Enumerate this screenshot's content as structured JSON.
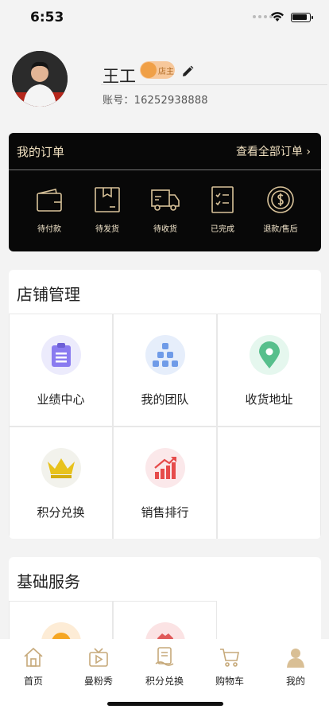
{
  "status_bar": {
    "time": "6:53"
  },
  "profile": {
    "name": "王工",
    "badge": "店主",
    "account_label": "账号：16252938888"
  },
  "orders": {
    "title": "我的订单",
    "view_all": "查看全部订单 ›",
    "items": [
      {
        "label": "待付款",
        "icon": "wallet-icon"
      },
      {
        "label": "待发货",
        "icon": "package-icon"
      },
      {
        "label": "待收货",
        "icon": "truck-icon"
      },
      {
        "label": "已完成",
        "icon": "checklist-icon"
      },
      {
        "label": "退款/售后",
        "icon": "refund-icon"
      }
    ]
  },
  "store_management": {
    "title": "店铺管理",
    "items": [
      {
        "label": "业绩中心",
        "icon": "clipboard-icon",
        "color": "#8a7bf0"
      },
      {
        "label": "我的团队",
        "icon": "team-icon",
        "color": "#6f9be8"
      },
      {
        "label": "收货地址",
        "icon": "location-pin-icon",
        "color": "#57bf8c"
      },
      {
        "label": "积分兑换",
        "icon": "crown-icon",
        "color": "#e8c21c"
      },
      {
        "label": "销售排行",
        "icon": "trending-chart-icon",
        "color": "#e64b4b"
      }
    ]
  },
  "basic_services": {
    "title": "基础服务"
  },
  "tabbar": {
    "items": [
      {
        "label": "首页",
        "icon": "home-icon"
      },
      {
        "label": "曼粉秀",
        "icon": "tv-play-icon"
      },
      {
        "label": "积分兑换",
        "icon": "points-icon"
      },
      {
        "label": "购物车",
        "icon": "cart-icon"
      },
      {
        "label": "我的",
        "icon": "user-icon"
      }
    ]
  },
  "colors": {
    "order_panel": "#080808",
    "gold_text": "#f0e0c0",
    "badge": "#f7c89b"
  }
}
